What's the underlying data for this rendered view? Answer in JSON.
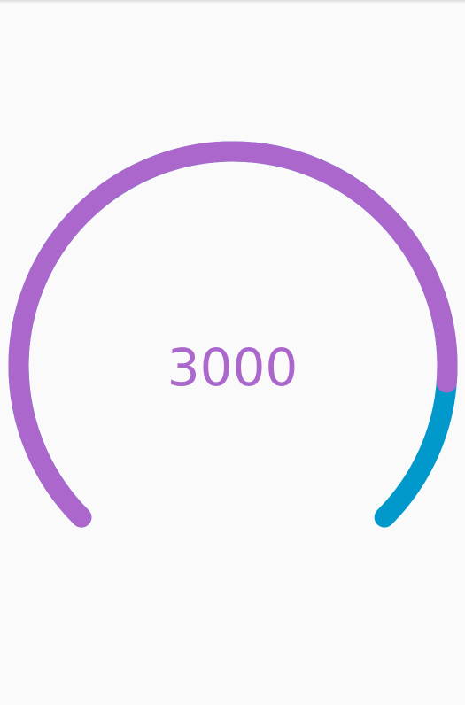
{
  "gauge": {
    "value_text": "3000",
    "progress_fraction": 0.85,
    "colors": {
      "progress": "#ab67cc",
      "remaining": "#0199cb",
      "text": "#ab67cc"
    }
  }
}
